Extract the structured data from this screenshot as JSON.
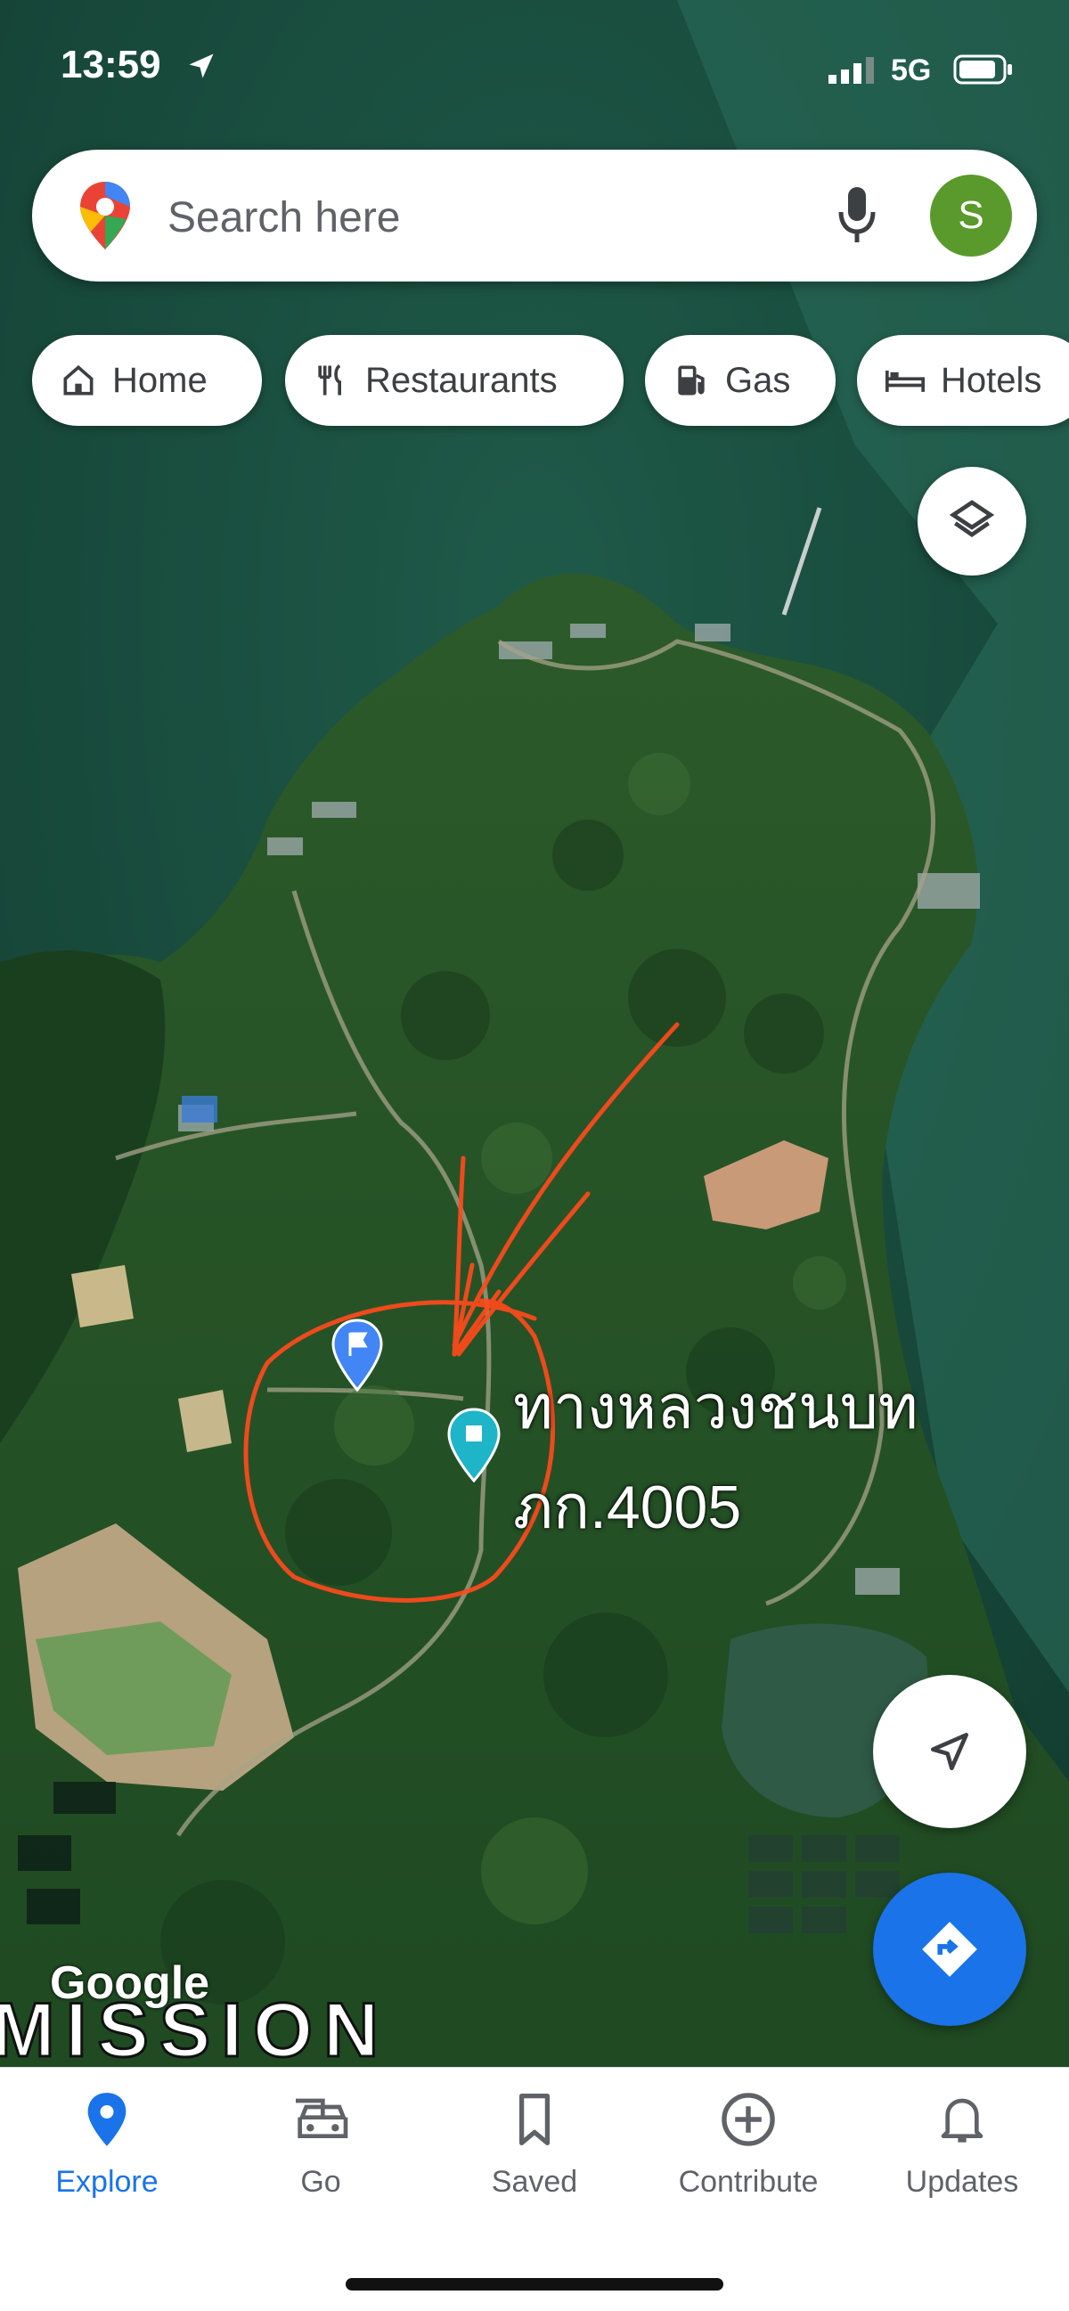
{
  "status_bar": {
    "time": "13:59",
    "network": "5G"
  },
  "search": {
    "placeholder": "Search here",
    "avatar_letter": "S"
  },
  "chips": [
    {
      "label": "Home",
      "icon": "home-icon"
    },
    {
      "label": "Restaurants",
      "icon": "restaurant-icon"
    },
    {
      "label": "Gas",
      "icon": "gas-station-icon"
    },
    {
      "label": "Hotels",
      "icon": "bed-icon"
    }
  ],
  "map": {
    "place_label_line1": "ทางหลวงชนบท",
    "place_label_line2": "ภก.4005",
    "attribution": "Google",
    "watermark": "MISSION"
  },
  "nav": [
    {
      "label": "Explore",
      "icon": "explore-pin-icon",
      "active": true
    },
    {
      "label": "Go",
      "icon": "car-icon",
      "active": false
    },
    {
      "label": "Saved",
      "icon": "bookmark-icon",
      "active": false
    },
    {
      "label": "Contribute",
      "icon": "add-circle-icon",
      "active": false
    },
    {
      "label": "Updates",
      "icon": "bell-icon",
      "active": false
    }
  ],
  "colors": {
    "accent": "#1a73e8",
    "annotation": "#ff4a1c",
    "pin_teal": "#1eb5c8",
    "avatar": "#5a9a2c"
  }
}
